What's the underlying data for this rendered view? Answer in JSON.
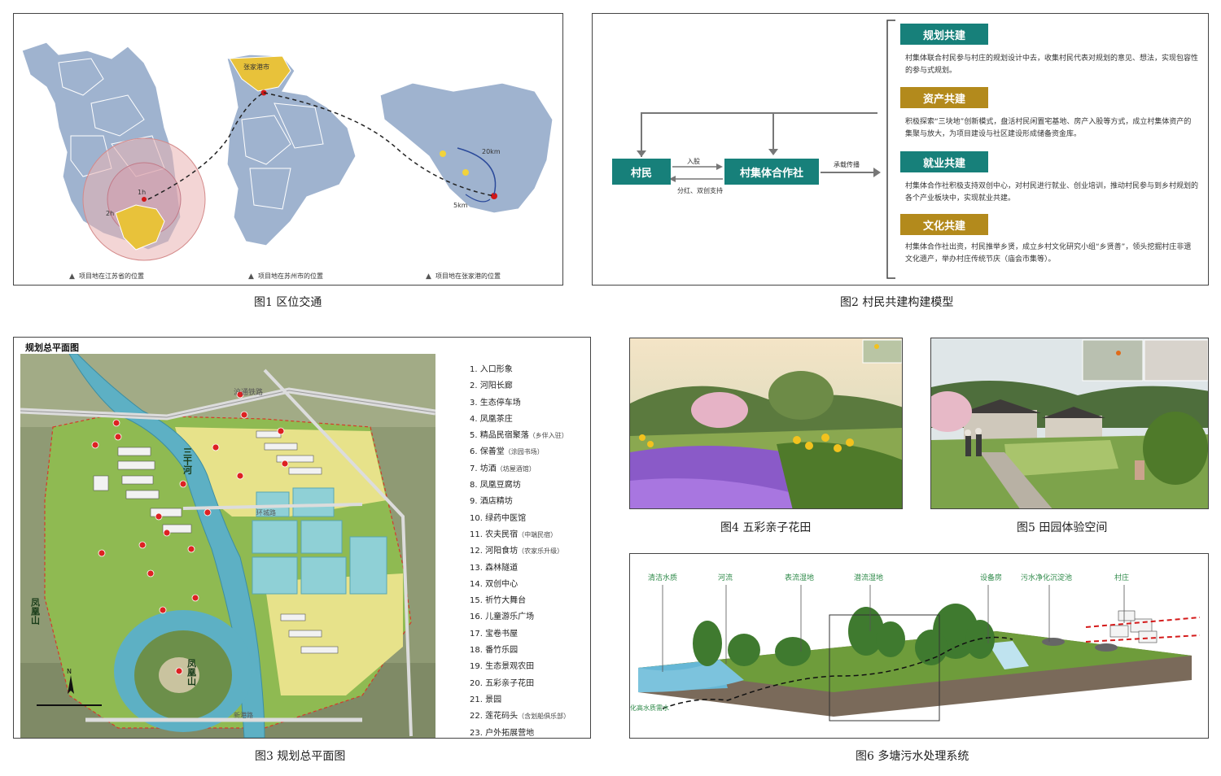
{
  "fig1": {
    "caption": "图1 区位交通",
    "maps": [
      {
        "caption": "项目地在江苏省的位置",
        "ring_labels": [
          "1h",
          "2h"
        ]
      },
      {
        "caption": "项目地在苏州市的位置",
        "city": "张家港市"
      },
      {
        "caption": "项目地在张家港的位置",
        "distance_labels": [
          "20km",
          "5km"
        ]
      }
    ]
  },
  "fig2": {
    "caption": "图2 村民共建构建模型",
    "villager": "村民",
    "coop": "村集体合作社",
    "arrow_top": "入股",
    "arrow_bottom": "分红、双创支持",
    "arrow_out": "承载传播",
    "items": [
      {
        "title": "规划共建",
        "color": "#17807a",
        "text": "村集体联合村民参与村庄的规划设计中去，收集村民代表对规划的意见、想法，实现包容性的参与式规划。"
      },
      {
        "title": "资产共建",
        "color": "#b38a1c",
        "text": "积极探索“三块地”创新模式，盘活村民闲置宅基地、房产入股等方式，成立村集体资产的集聚与放大，为项目建设与社区建设形成储备资金库。"
      },
      {
        "title": "就业共建",
        "color": "#17807a",
        "text": "村集体合作社积极支持双创中心，对村民进行就业、创业培训，推动村民参与到乡村规划的各个产业板块中，实现就业共建。"
      },
      {
        "title": "文化共建",
        "color": "#b38a1c",
        "text": "村集体合作社出资，村民推举乡贤，成立乡村文化研究小组“乡贤善”，领头挖掘村庄非遗文化遗产，举办村庄传统节庆（庙会市集等）。"
      }
    ]
  },
  "fig3": {
    "caption": "图3 规划总平面图",
    "title": "规划总平面图",
    "map_labels": {
      "road_top": "沪通铁路",
      "road_h": "环城路",
      "road_bottom": "新港路",
      "canal": "三干河",
      "mountain_left": "凤凰山",
      "mountain_center": "凤凰山"
    },
    "legend": [
      {
        "text": "1. 入口形象",
        "note": ""
      },
      {
        "text": "2. 河阳长廊",
        "note": ""
      },
      {
        "text": "3. 生态停车场",
        "note": ""
      },
      {
        "text": "4. 凤凰茶庄",
        "note": ""
      },
      {
        "text": "5. 精品民宿聚落",
        "note": "（乡伴入驻）"
      },
      {
        "text": "6. 保善堂",
        "note": "（涂园书场）"
      },
      {
        "text": "7. 坊酒",
        "note": "（坊屋酒馆）"
      },
      {
        "text": "8. 凤凰豆腐坊",
        "note": ""
      },
      {
        "text": "9. 酒店精坊",
        "note": ""
      },
      {
        "text": "10. 绿药中医馆",
        "note": ""
      },
      {
        "text": "11. 农夫民宿",
        "note": "（中端民宿）"
      },
      {
        "text": "12. 河阳食坊",
        "note": "（农家乐升级）"
      },
      {
        "text": "13. 森林隧道",
        "note": ""
      },
      {
        "text": "14. 双创中心",
        "note": ""
      },
      {
        "text": "15. 祈竹大舞台",
        "note": ""
      },
      {
        "text": "16. 儿童游乐广场",
        "note": ""
      },
      {
        "text": "17. 宝卷书屋",
        "note": ""
      },
      {
        "text": "18. 番竹乐园",
        "note": ""
      },
      {
        "text": "19. 生态景观农田",
        "note": ""
      },
      {
        "text": "20. 五彩亲子花田",
        "note": ""
      },
      {
        "text": "21. 景园",
        "note": ""
      },
      {
        "text": "22. 莲花码头",
        "note": "（含划船俱乐部）"
      },
      {
        "text": "23. 户外拓展营地",
        "note": ""
      }
    ]
  },
  "fig4": {
    "caption": "图4 五彩亲子花田"
  },
  "fig5": {
    "caption": "图5 田园体验空间"
  },
  "fig6": {
    "caption": "图6 多塘污水处理系统",
    "labels": [
      "清洁水质",
      "河流",
      "表流湿地",
      "潜流湿地",
      "设备房",
      "污水净化沉淀池",
      "村庄"
    ],
    "side_label": "化高水质需水"
  },
  "colors": {
    "teal": "#17807a",
    "gold": "#b38a1c",
    "map_blue": "#9fb3cf",
    "map_yellow": "#e8c23a"
  }
}
